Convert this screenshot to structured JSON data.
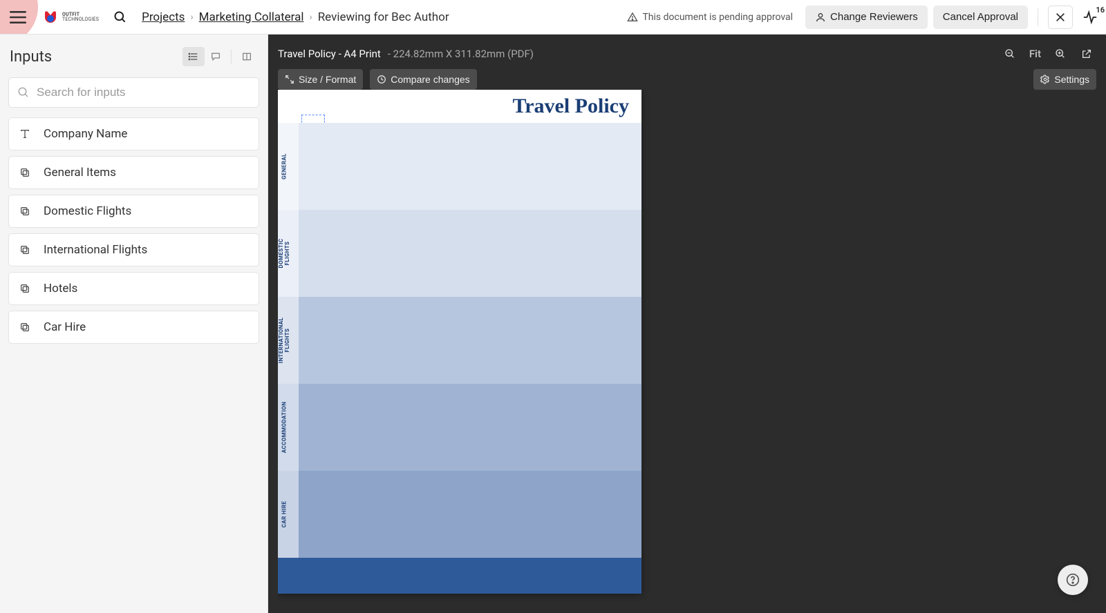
{
  "brand": {
    "name": "OUTFIT",
    "sub": "TECHNOLOGIES"
  },
  "breadcrumbs": {
    "projects": "Projects",
    "folder": "Marketing Collateral",
    "doc": "Reviewing for Bec Author"
  },
  "header": {
    "pending_text": "This document is pending approval",
    "change_reviewers": "Change Reviewers",
    "cancel_approval": "Cancel Approval",
    "activity_count": "16"
  },
  "sidebar": {
    "title": "Inputs",
    "search_placeholder": "Search for inputs",
    "items": [
      {
        "icon": "text",
        "label": "Company Name"
      },
      {
        "icon": "copy",
        "label": "General Items"
      },
      {
        "icon": "copy",
        "label": "Domestic Flights"
      },
      {
        "icon": "copy",
        "label": "International Flights"
      },
      {
        "icon": "copy",
        "label": "Hotels"
      },
      {
        "icon": "copy",
        "label": "Car Hire"
      }
    ]
  },
  "doc": {
    "name": "Travel Policy - A4 Print",
    "dims": "- 224.82mm X 311.82mm (PDF)",
    "size_format": "Size / Format",
    "compare": "Compare changes",
    "fit": "Fit",
    "settings": "Settings",
    "page_title": "Travel Policy",
    "sections": [
      "GENERAL",
      "DOMESTIC\nFLIGHTS",
      "INTERNATIONAL\nFLIGHTS",
      "ACCOMMODATION",
      "CAR HIRE"
    ]
  }
}
